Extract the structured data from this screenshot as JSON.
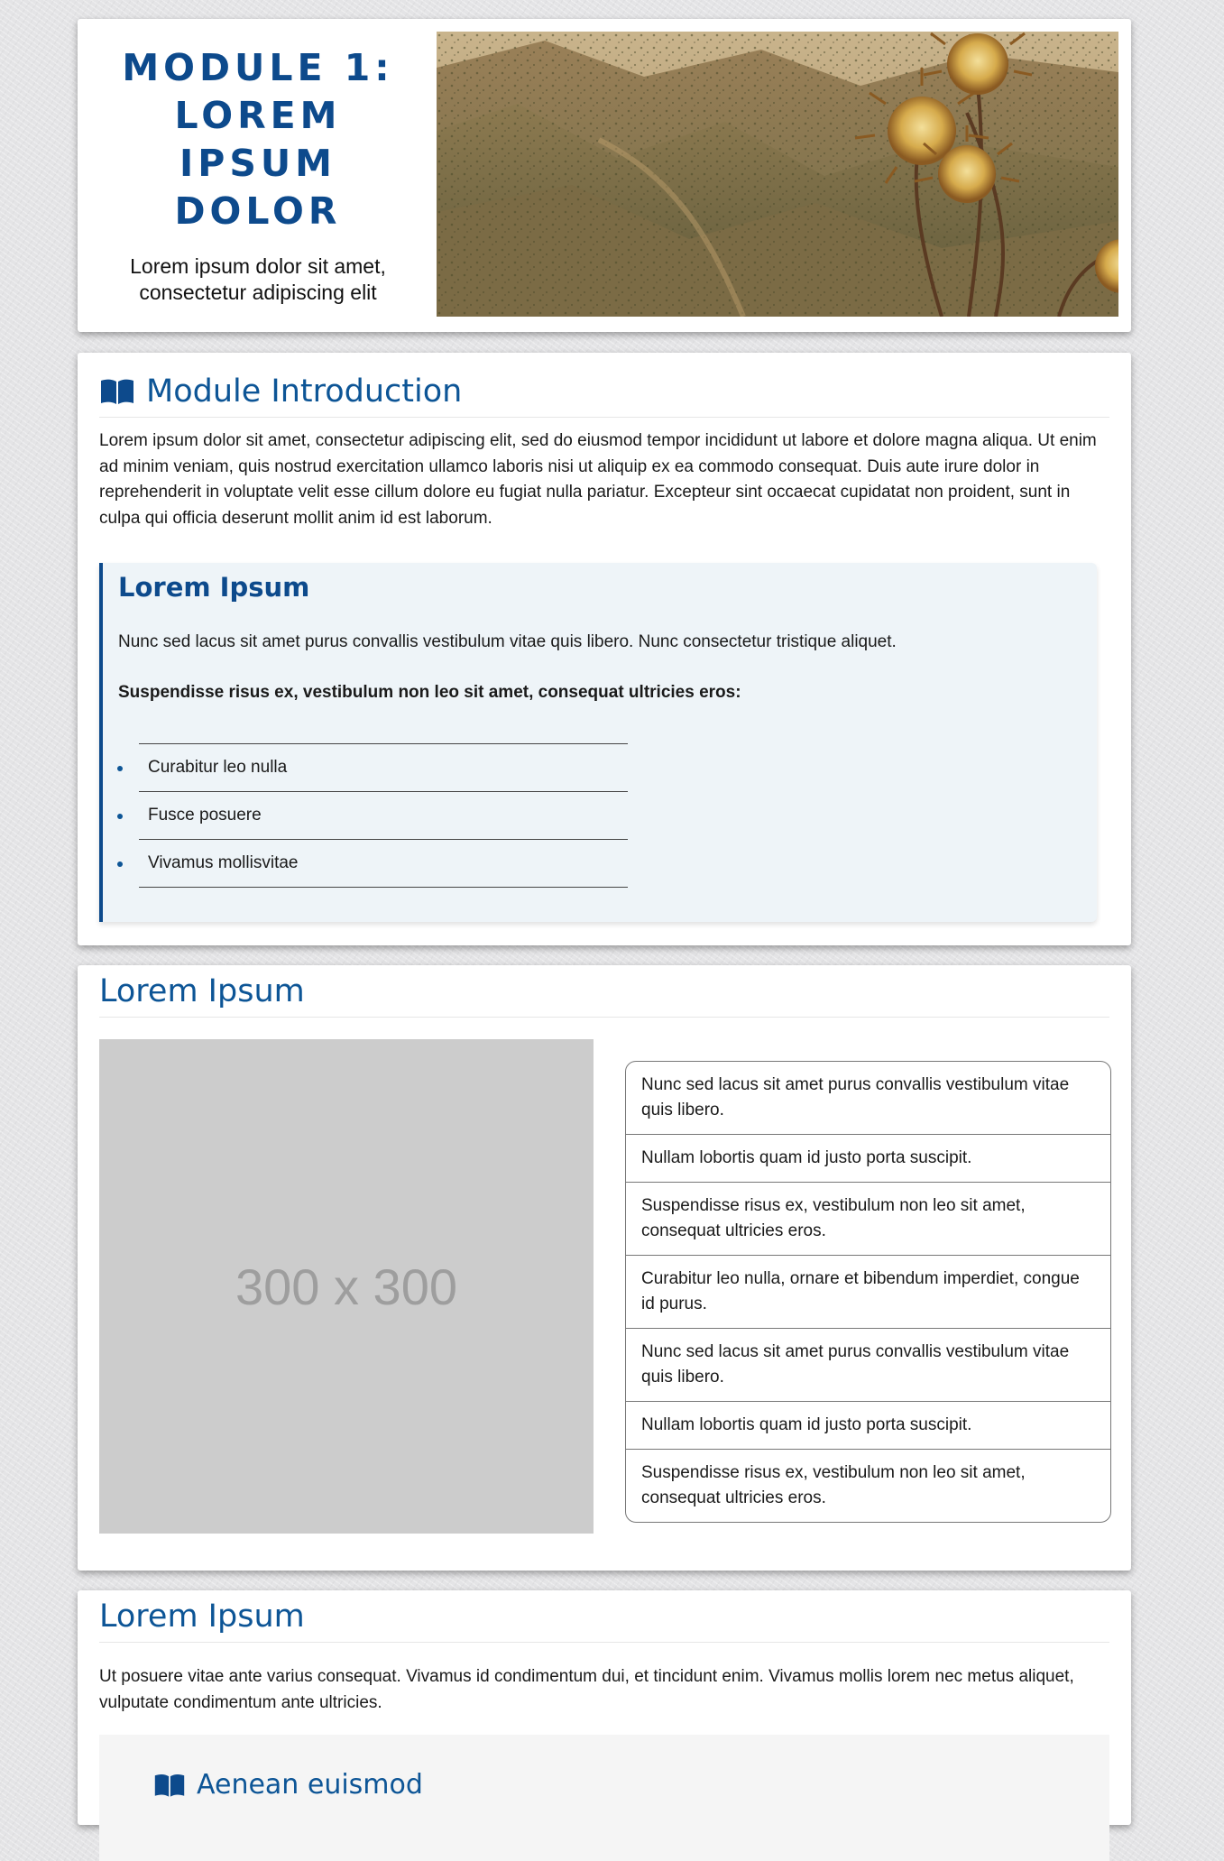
{
  "hero": {
    "title_lines": [
      "MODULE 1:",
      "LOREM",
      "IPSUM",
      "DOLOR"
    ],
    "subtitle": "Lorem ipsum dolor sit amet, consectetur adipiscing elit"
  },
  "intro": {
    "icon": "book-open-icon",
    "title": "Module Introduction",
    "paragraph": "Lorem ipsum dolor sit amet, consectetur adipiscing elit, sed do eiusmod tempor incididunt ut labore et dolore magna aliqua. Ut enim ad minim veniam, quis nostrud exercitation ullamco laboris nisi ut aliquip ex ea commodo consequat. Duis aute irure dolor in reprehenderit in voluptate velit esse cillum dolore eu fugiat nulla pariatur. Excepteur sint occaecat cupidatat non proident, sunt in culpa qui officia deserunt mollit anim id est laborum.",
    "callout": {
      "title": "Lorem Ipsum",
      "text": "Nunc sed lacus sit amet purus convallis vestibulum vitae quis libero. Nunc consectetur tristique aliquet.",
      "bold_text": "Suspendisse risus ex, vestibulum non leo sit amet, consequat ultricies eros:",
      "items": [
        "Curabitur leo nulla",
        "Fusce posuere",
        "Vivamus mollisvitae"
      ]
    }
  },
  "section2": {
    "title": "Lorem Ipsum",
    "placeholder_text": "300 x 300",
    "items": [
      "Nunc sed lacus sit amet purus convallis vestibulum vitae quis libero.",
      "Nullam lobortis quam id justo porta suscipit.",
      "Suspendisse risus ex, vestibulum non leo sit amet, consequat ultricies eros.",
      "Curabitur leo nulla, ornare et bibendum imperdiet, congue id purus.",
      "Nunc sed lacus sit amet purus convallis vestibulum vitae quis libero.",
      "Nullam lobortis quam id justo porta suscipit.",
      "Suspendisse risus ex, vestibulum non leo sit amet, consequat ultricies eros."
    ]
  },
  "section3": {
    "title": "Lorem Ipsum",
    "paragraph": "Ut posuere vitae ante varius consequat. Vivamus id condimentum dui, et tincidunt enim. Vivamus mollis lorem nec metus aliquet, vulputate condimentum ante ultricies.",
    "subpanel_icon": "book-open-icon",
    "subpanel_title": "Aenean euismod"
  },
  "colors": {
    "brand_blue": "#0d4a8c",
    "heading_blue": "#0d5596",
    "callout_bg": "#eef4f8",
    "placeholder_gray": "#cccccc"
  }
}
